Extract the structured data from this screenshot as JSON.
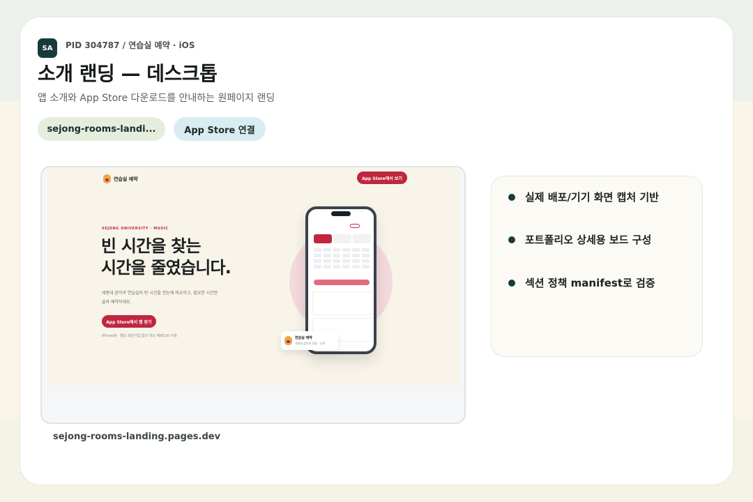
{
  "header": {
    "avatar": "SA",
    "pid": "PID 304787 / 연습실 예약 · iOS",
    "title": "소개 랜딩 — 데스크톱",
    "subtitle": "앱 소개와 App Store 다운로드를 안내하는 원페이지 랜딩"
  },
  "chips": {
    "repo": "sejong-rooms-landi...",
    "store": "App Store 연결"
  },
  "preview": {
    "nav_brand": "연습실 예약",
    "nav_button": "App Store에서 보기",
    "eyebrow": "SEJONG UNIVERSITY · MUSIC",
    "hero_line1": "빈 시간을 찾는",
    "hero_line2": "시간을 줄였습니다.",
    "description_line1": "세종대 음악과 연습실의 빈 시간을 한눈에 비교하고, 필요한 시간만",
    "description_line2": "골라 예약하세요.",
    "cta": "App Store에서 앱 받기",
    "note": "iPhone용 · 별도 회원가입 없이 학교 계정으로 이용",
    "toast_title": "연습실 예약",
    "toast_sub": "세종대 음악과 전용 · 무료",
    "url": "sejong-rooms-landing.pages.dev"
  },
  "features": [
    {
      "label": "실제 배포/기기 화면 캡처 기반"
    },
    {
      "label": "포트폴리오 상세용 보드 구성"
    },
    {
      "label": "섹션 정책 manifest로 검증"
    }
  ],
  "colors": {
    "accent": "#c0273f",
    "dark": "#173b3d",
    "chip_green": "#e5eedd",
    "chip_blue": "#d8ecf1"
  }
}
